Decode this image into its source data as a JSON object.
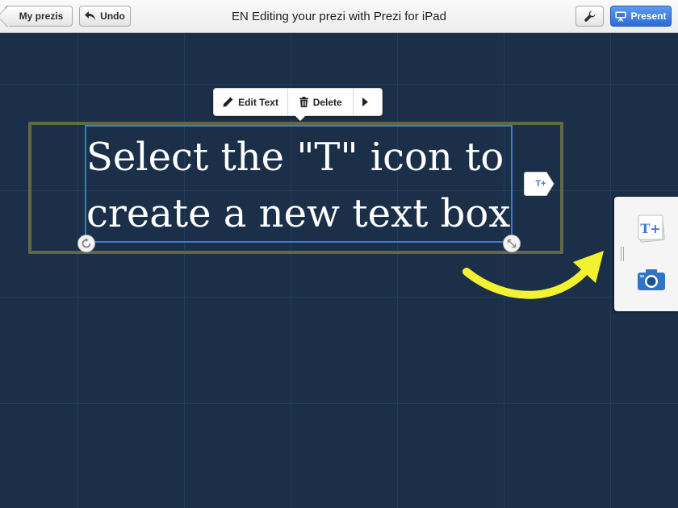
{
  "topbar": {
    "back_label": "My prezis",
    "undo_label": "Undo",
    "title": "EN Editing your prezi with Prezi for iPad",
    "present_label": "Present",
    "tool_icon": "wrench-icon"
  },
  "context_menu": {
    "edit_label": "Edit Text",
    "delete_label": "Delete",
    "more_icon": "play-triangle-icon"
  },
  "canvas": {
    "text_line1": "Select the \"T\" icon to",
    "text_line2": "create a new text box",
    "t_tag_label": "T+"
  },
  "side_panel": {
    "text_tool_label": "T+",
    "camera_icon": "camera-icon"
  },
  "colors": {
    "canvas_bg": "#1b3048",
    "selection": "#3c78d8",
    "frame": "#5f6a44",
    "arrow": "#f2f230",
    "present_button": "#2b6cd8"
  }
}
